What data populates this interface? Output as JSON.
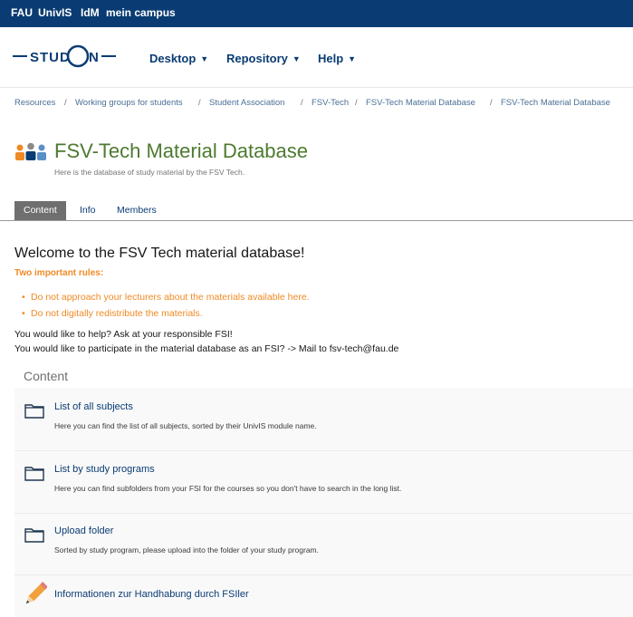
{
  "topbar": {
    "links": [
      "FAU",
      "UnivIS",
      "IdM",
      "mein campus"
    ]
  },
  "logo": {
    "text_left": "STUD",
    "text_right": "N"
  },
  "menu": {
    "items": [
      "Desktop",
      "Repository",
      "Help"
    ]
  },
  "breadcrumb": {
    "items": [
      "Resources",
      "Working groups for students",
      "Student Association",
      "FSV-Tech",
      "FSV-Tech Material Database",
      "FSV-Tech Material Database"
    ],
    "separator": "/"
  },
  "page": {
    "title": "FSV-Tech Material Database",
    "description": "Here is the database of study material by the FSV Tech."
  },
  "tabs": [
    "Content",
    "Info",
    "Members"
  ],
  "welcome": {
    "heading": "Welcome to the FSV Tech material database!",
    "rules_heading": "Two important rules:",
    "rules": [
      "Do not approach your lecturers about the materials available here.",
      "Do not digitally redistribute the materials."
    ],
    "help_line": "You would like to help? Ask at your responsible FSI!",
    "participate_line": "You would like to participate in the material database as an FSI? -> Mail to fsv-tech@fau.de"
  },
  "content": {
    "heading": "Content",
    "items": [
      {
        "title": "List of all subjects",
        "description": "Here you can find the list of all subjects, sorted by their UnivIS module name.",
        "icon": "folder-icon"
      },
      {
        "title": "List by study programs",
        "description": "Here you can find subfolders from your FSI for the courses so you don't have to search in the long list.",
        "icon": "folder-icon"
      },
      {
        "title": "Upload folder",
        "description": "Sorted by study program, please upload into the folder of your study program.",
        "icon": "folder-icon"
      },
      {
        "title": "Informationen zur Handhabung durch FSIler",
        "description": "",
        "icon": "pencil-icon"
      }
    ]
  },
  "colors": {
    "topbar": "#0a3c73",
    "link": "#0a3c73",
    "title": "#4d7a30",
    "rules": "#f08a24",
    "active_tab": "#6f6f6f"
  }
}
